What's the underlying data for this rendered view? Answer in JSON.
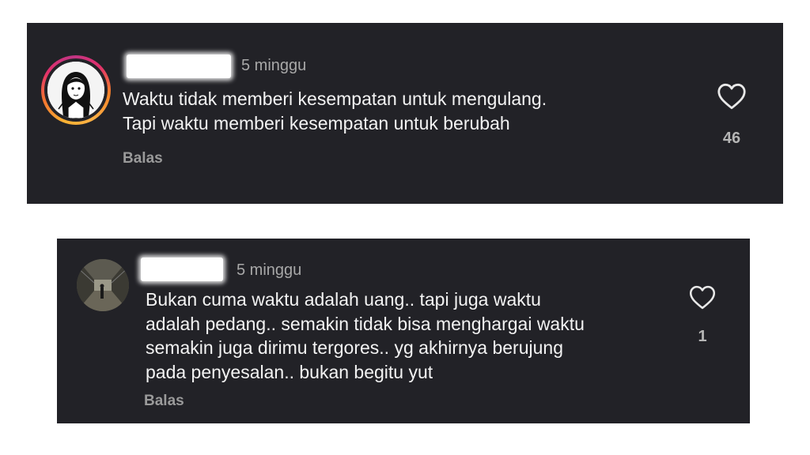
{
  "comments": [
    {
      "time": "5 minggu",
      "text": "Waktu tidak memberi kesempatan untuk mengulang.\nTapi waktu memberi kesempatan untuk berubah",
      "reply_label": "Balas",
      "like_count": "46",
      "avatar_icon": "avatar-illustration-girl",
      "has_story_ring": true
    },
    {
      "time": "5 minggu",
      "text": "Bukan cuma waktu adalah uang.. tapi juga waktu\nadalah pedang.. semakin tidak bisa menghargai waktu\nsemakin juga dirimu tergores.. yg akhirnya berujung\npada penyesalan.. bukan begitu yut",
      "reply_label": "Balas",
      "like_count": "1",
      "avatar_icon": "avatar-photo-corridor",
      "has_story_ring": false
    }
  ],
  "colors": {
    "card_background": "#222227",
    "text_primary": "#f3f3f3",
    "text_secondary": "#a8a8a8",
    "story_ring": [
      "#f9b233",
      "#e1306c",
      "#c13584"
    ]
  }
}
